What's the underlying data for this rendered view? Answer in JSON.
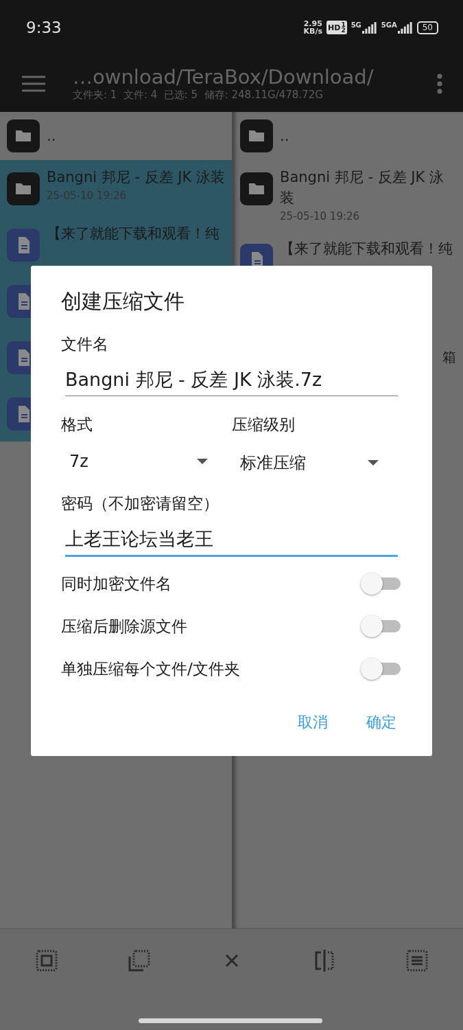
{
  "status_bar": {
    "time": "9:33",
    "speed": [
      "2.95",
      "KB/s"
    ],
    "hd": "HD",
    "hd_fraction": [
      "1",
      "2"
    ],
    "signals": [
      "5G",
      "5GA"
    ],
    "battery": "50"
  },
  "app_bar": {
    "path": "…ownload/TeraBox/Download/",
    "summary": "文件夹: 1  文件: 4  已选: 5  储存: 248.11G/478.72G"
  },
  "panes": [
    {
      "rows": [
        {
          "kind": "folder",
          "name": "..",
          "selected": false
        },
        {
          "kind": "folder",
          "name": "Bangni 邦尼 - 反差 JK 泳装",
          "date": "25-05-10 19:26",
          "selected": true
        },
        {
          "kind": "file",
          "name": "【来了就能下载和观看！纯",
          "selected": true
        },
        {
          "kind": "file",
          "selected": true
        },
        {
          "kind": "file",
          "selected": true
        },
        {
          "kind": "file",
          "selected": true
        }
      ]
    },
    {
      "rows": [
        {
          "kind": "folder",
          "name": "..",
          "selected": false
        },
        {
          "kind": "folder",
          "name": "Bangni 邦尼 - 反差 JK 泳装",
          "date": "25-05-10 19:26",
          "selected": false
        },
        {
          "kind": "file",
          "name": "【来了就能下载和观看！纯",
          "selected": false
        },
        {
          "kind": "fragment",
          "name": "箱",
          "selected": false
        }
      ]
    }
  ],
  "dialog": {
    "title": "创建压缩文件",
    "filename_label": "文件名",
    "filename": "Bangni 邦尼 - 反差 JK 泳装.7z",
    "format_label": "格式",
    "format": "7z",
    "level_label": "压缩级别",
    "level_value": "标准压缩",
    "password_label": "密码（不加密请留空）",
    "password": "上老王论坛当老王",
    "password_focused": true,
    "toggles": [
      {
        "label": "同时加密文件名",
        "on": false
      },
      {
        "label": "压缩后删除源文件",
        "on": false
      },
      {
        "label": "单独压缩每个文件/文件夹",
        "on": false
      }
    ],
    "buttons": [
      "取消",
      "确定"
    ]
  },
  "toolbar": [
    {
      "kind": "select-all"
    },
    {
      "kind": "select-range"
    },
    {
      "kind": "close"
    },
    {
      "kind": "invert"
    },
    {
      "kind": "select-list"
    }
  ]
}
